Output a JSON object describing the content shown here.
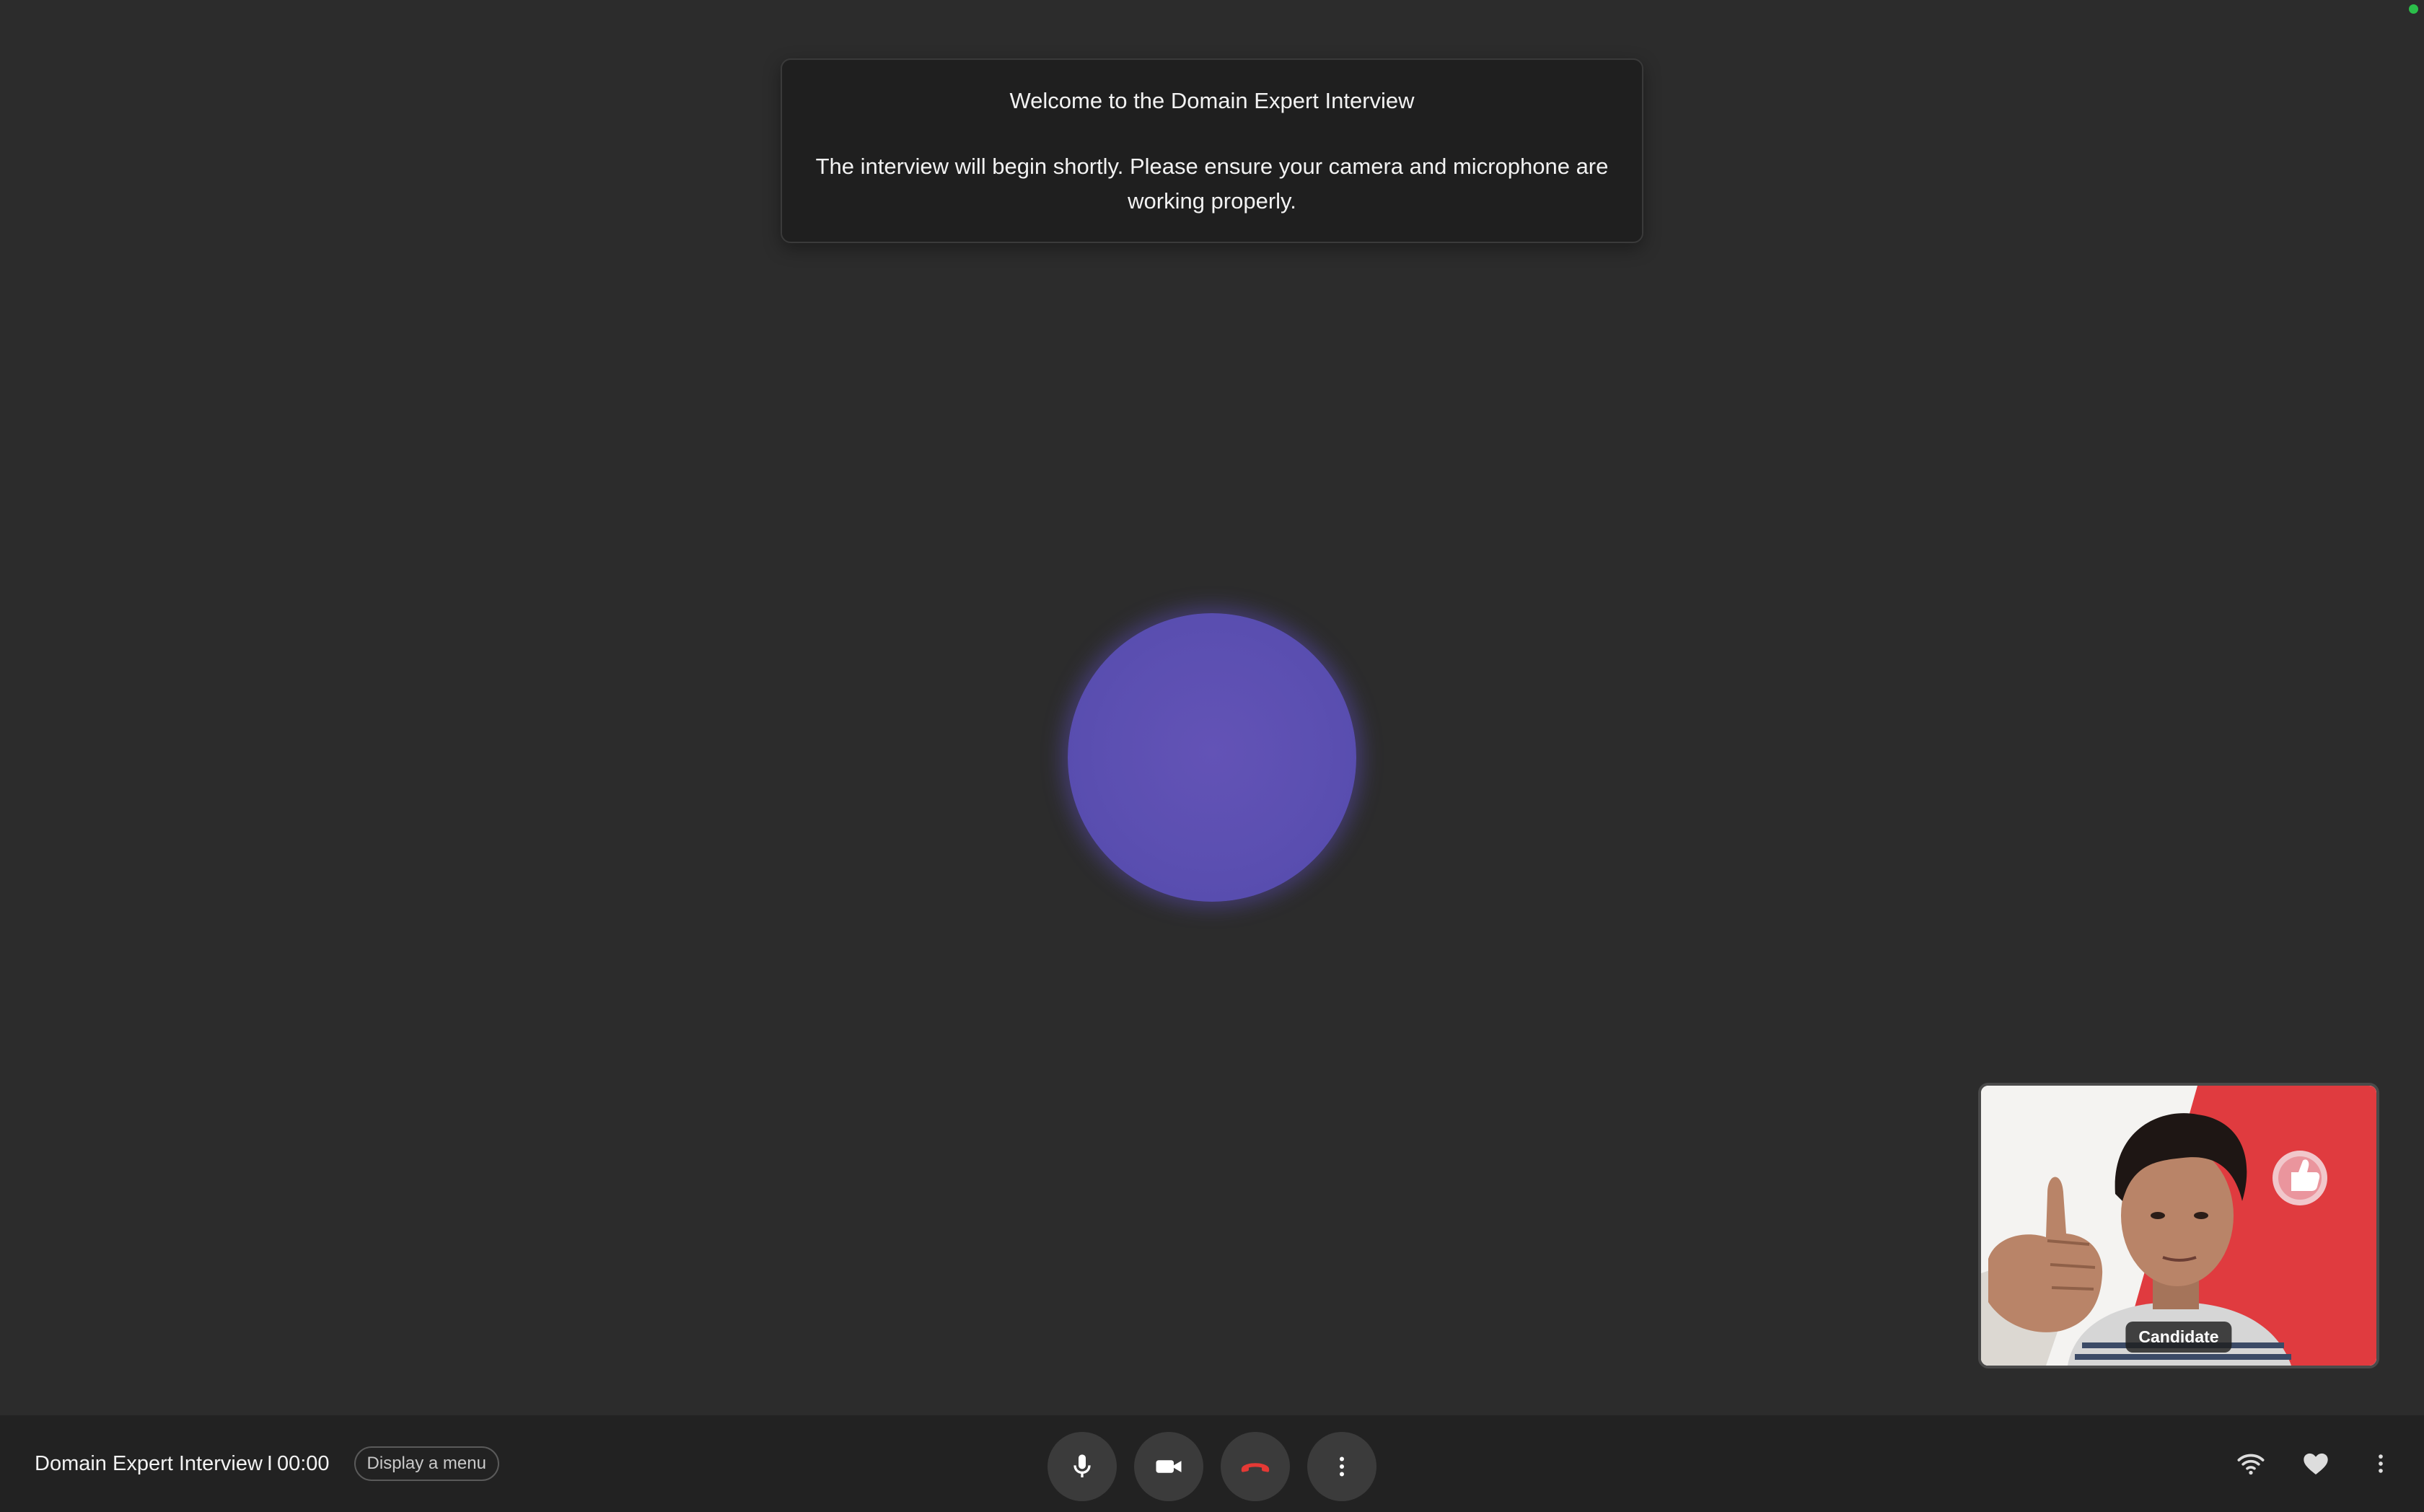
{
  "welcome": {
    "title": "Welcome to the Domain Expert Interview",
    "message": "The interview will begin shortly. Please ensure your camera and microphone are working properly."
  },
  "self_view": {
    "participant_label": "Candidate"
  },
  "bottom_bar": {
    "meeting_title": "Domain Expert Interview",
    "separator": "I",
    "timer": "00:00",
    "menu_button_label": "Display a menu",
    "controls": [
      {
        "name": "microphone-icon",
        "kind": "microphone"
      },
      {
        "name": "camera-icon",
        "kind": "video-camera"
      },
      {
        "name": "hang-up-icon",
        "kind": "end-call"
      },
      {
        "name": "more-options-icon",
        "kind": "vertical-dots"
      }
    ],
    "right_icons": [
      "wifi-icon",
      "heart-icon",
      "more-vert-icon"
    ]
  },
  "colors": {
    "background": "#2c2c2c",
    "card_background": "#1f1f1f",
    "orb": "#5b4fb1",
    "bar_background": "#222222",
    "button_background": "#3b3b3b",
    "hang_up": "#e53935",
    "status_dot": "#2bbf4a"
  }
}
